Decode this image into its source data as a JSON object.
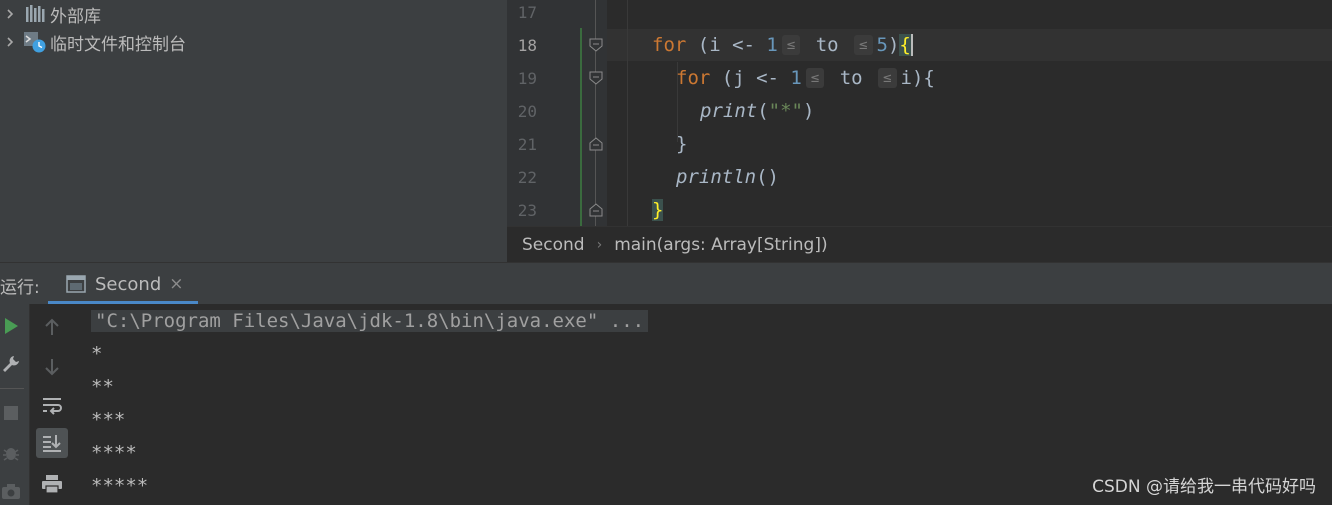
{
  "project_tree": {
    "items": [
      {
        "label": "外部库",
        "icon": "library-icon"
      },
      {
        "label": "临时文件和控制台",
        "icon": "scratches-icon"
      }
    ]
  },
  "editor": {
    "line_numbers": [
      "17",
      "18",
      "19",
      "20",
      "21",
      "22",
      "23"
    ],
    "current_line": "18",
    "code": {
      "l18": {
        "kw": "for",
        "open": " (i <- ",
        "from": "1",
        "hint1": "≤",
        "to": " to ",
        "hint2": "≤",
        "limit": "5",
        "close": ")",
        "brace": "{"
      },
      "l19": {
        "kw": "for",
        "open": " (j <- ",
        "from": "1",
        "hint1": "≤",
        "to": " to ",
        "hint2": "≤",
        "tail": "i){"
      },
      "l20": {
        "fn": "print",
        "open": "(",
        "str": "\"*\"",
        "close": ")"
      },
      "l21": {
        "text": "}"
      },
      "l22": {
        "fn": "println",
        "tail": "()"
      },
      "l23": {
        "brace": "}"
      }
    }
  },
  "breadcrumb": {
    "items": [
      "Second",
      "main(args: Array[String])"
    ]
  },
  "run_window": {
    "label": "运行:",
    "tab_label": "Second",
    "close_symbol": "×"
  },
  "console": {
    "command": "\"C:\\Program Files\\Java\\jdk-1.8\\bin\\java.exe\" ...",
    "output": [
      "*",
      "**",
      "***",
      "****",
      "*****"
    ]
  },
  "watermark": "CSDN @请给我一串代码好吗",
  "colors": {
    "keyword": "#cc7832",
    "number": "#6897bb",
    "string": "#6a8759",
    "run_green": "#499c54",
    "tab_underline": "#4a88c7"
  }
}
